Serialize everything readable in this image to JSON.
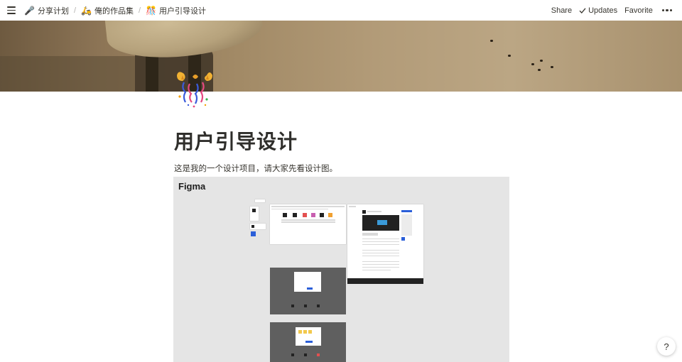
{
  "topbar": {
    "breadcrumbs": [
      {
        "icon": "🎤",
        "label": "分享计划"
      },
      {
        "icon": "🛵",
        "label": "俺的作品集"
      },
      {
        "icon": "🎊",
        "label": "用户引导设计"
      }
    ],
    "separator": "/",
    "share_label": "Share",
    "updates_label": "Updates",
    "favorite_label": "Favorite"
  },
  "page": {
    "icon": "confetti-ball-icon",
    "title": "用户引导设计",
    "paragraph": "这是我的一个设计项目，请大家先看设计图。"
  },
  "embed": {
    "label": "Figma"
  },
  "help": {
    "label": "?"
  }
}
